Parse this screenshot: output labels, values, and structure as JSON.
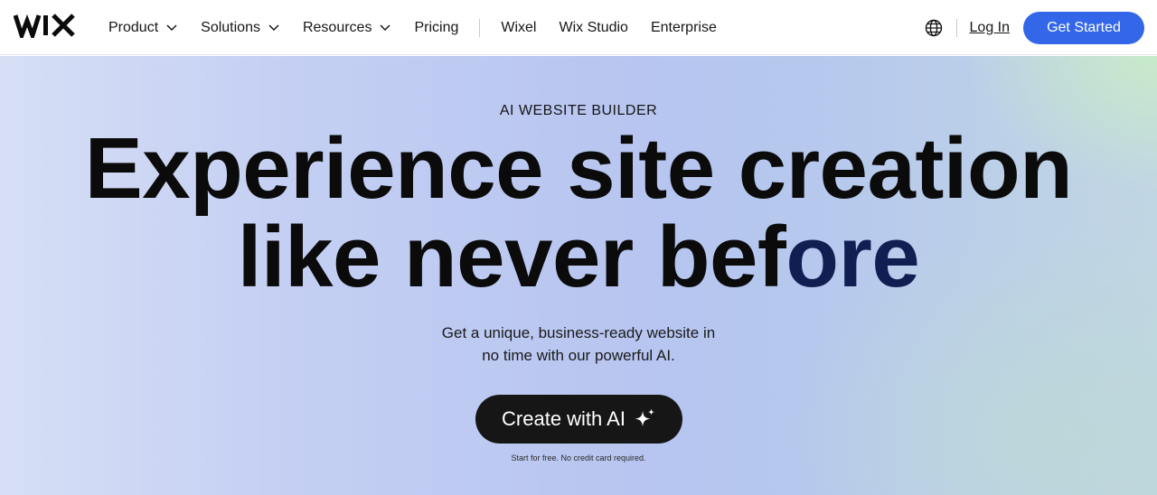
{
  "header": {
    "logo_text": "WIX",
    "nav": {
      "product": "Product",
      "solutions": "Solutions",
      "resources": "Resources",
      "pricing": "Pricing",
      "wixel": "Wixel",
      "wix_studio": "Wix Studio",
      "enterprise": "Enterprise"
    },
    "login": "Log In",
    "get_started": "Get Started",
    "icons": {
      "language": "globe-icon",
      "dropdown": "chevron-down-icon"
    }
  },
  "hero": {
    "eyebrow": "AI WEBSITE BUILDER",
    "headline_line1": "Experience site creation",
    "headline_line2_a": "like never bef",
    "headline_line2_b": "ore",
    "subtitle_line1": "Get a unique, business-ready website in",
    "subtitle_line2": "no time with our powerful AI.",
    "cta_label": "Create with AI",
    "cta_icon": "sparkle-icon",
    "note": "Start for free. No credit card required."
  },
  "colors": {
    "accent": "#3366e8",
    "cta_background": "#161616",
    "headline_accent": "#101e52"
  }
}
